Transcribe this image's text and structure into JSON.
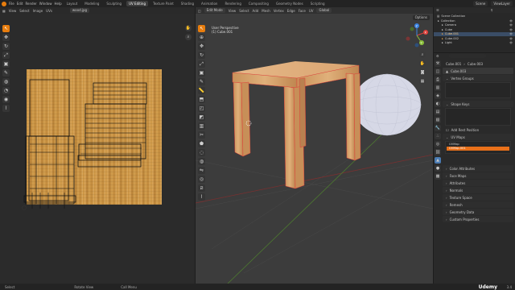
{
  "app": {
    "menu": [
      "File",
      "Edit",
      "Render",
      "Window",
      "Help"
    ],
    "tabs": [
      "Layout",
      "Modeling",
      "Sculpting",
      "UV Editing",
      "Texture Paint",
      "Shading",
      "Animation",
      "Rendering",
      "Compositing",
      "Geometry Nodes",
      "Scripting"
    ],
    "active_tab": "UV Editing",
    "scene_label": "Scene",
    "view_layer_label": "ViewLayer"
  },
  "uv_editor": {
    "menus": [
      "View",
      "Select",
      "Image",
      "UVs"
    ],
    "image_name": "wood.jpg",
    "tools": [
      "cursor",
      "move",
      "rotate",
      "scale",
      "transform",
      "annotate",
      "grab",
      "relax",
      "pinch",
      "rip"
    ],
    "nav": [
      "pan",
      "zoom"
    ]
  },
  "viewport": {
    "mode": "Edit Mode",
    "menus": [
      "View",
      "Select",
      "Add",
      "Mesh",
      "Vertex",
      "Edge",
      "Face",
      "UV"
    ],
    "orientation": "Global",
    "options_label": "Options",
    "view_name": "User Perspective",
    "object_name": "(1) Cube.001",
    "tools": [
      "cursor",
      "move",
      "rotate",
      "scale",
      "transform",
      "annotate",
      "measure",
      "extrude",
      "inset",
      "bevel",
      "loop-cut",
      "knife",
      "poly-build",
      "spin",
      "smooth",
      "edge-slide",
      "shrink",
      "shear",
      "rip"
    ],
    "nav": [
      "zoom",
      "pan",
      "camera",
      "perspective"
    ],
    "gizmo": {
      "x": "X",
      "y": "Y",
      "z": "Z"
    }
  },
  "outliner": {
    "title": "Scene Collection",
    "items": [
      {
        "label": "Collection",
        "indent": 1,
        "selected": false,
        "color": "#cfcfcf"
      },
      {
        "label": "Camera",
        "indent": 2,
        "selected": false,
        "color": "#cfcfcf"
      },
      {
        "label": "Cube",
        "indent": 2,
        "selected": false,
        "color": "#cfcfcf"
      },
      {
        "label": "Cube.001",
        "indent": 2,
        "selected": true,
        "color": "#e8a34a"
      },
      {
        "label": "Cube.002",
        "indent": 2,
        "selected": false,
        "color": "#e8a34a"
      },
      {
        "label": "Light",
        "indent": 2,
        "selected": false,
        "color": "#cfcfcf"
      }
    ]
  },
  "properties": {
    "breadcrumb": [
      "Cube.001",
      "Cube.003"
    ],
    "object_field": "Cube.003",
    "sections": {
      "vertex_groups": "Vertex Groups",
      "shape_keys": "Shape Keys",
      "add_rest_position": "Add Rest Position",
      "uv_maps": "UV Maps",
      "uv_items": [
        {
          "label": "UVMap",
          "active": false
        },
        {
          "label": "UVMap.001",
          "active": true
        }
      ],
      "collapsed": [
        "Color Attributes",
        "Face Maps",
        "Attributes",
        "Normals",
        "Texture Space",
        "Remesh",
        "Geometry Data",
        "Custom Properties"
      ]
    }
  },
  "status": {
    "select": "Select",
    "rotate": "Rotate View",
    "call_menu": "Call Menu",
    "watermark": "Udemy",
    "version": "3.4"
  }
}
